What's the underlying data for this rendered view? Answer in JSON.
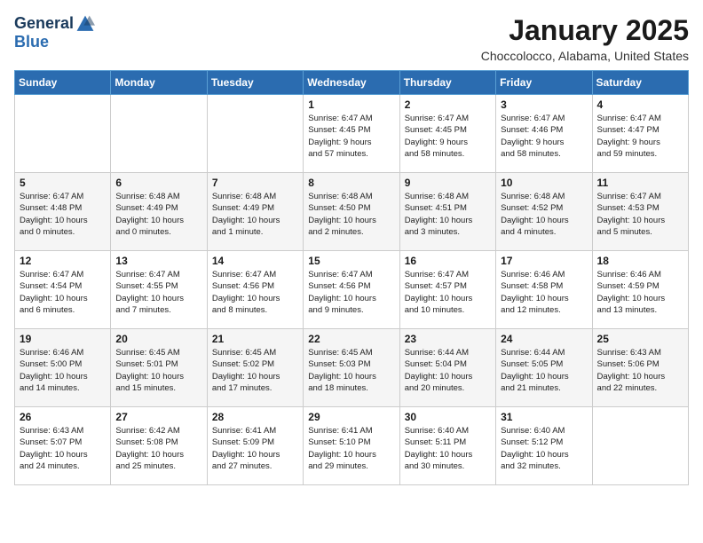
{
  "header": {
    "logo_general": "General",
    "logo_blue": "Blue",
    "title": "January 2025",
    "location": "Choccolocco, Alabama, United States"
  },
  "days_of_week": [
    "Sunday",
    "Monday",
    "Tuesday",
    "Wednesday",
    "Thursday",
    "Friday",
    "Saturday"
  ],
  "weeks": [
    [
      {
        "day": "",
        "info": ""
      },
      {
        "day": "",
        "info": ""
      },
      {
        "day": "",
        "info": ""
      },
      {
        "day": "1",
        "info": "Sunrise: 6:47 AM\nSunset: 4:45 PM\nDaylight: 9 hours\nand 57 minutes."
      },
      {
        "day": "2",
        "info": "Sunrise: 6:47 AM\nSunset: 4:45 PM\nDaylight: 9 hours\nand 58 minutes."
      },
      {
        "day": "3",
        "info": "Sunrise: 6:47 AM\nSunset: 4:46 PM\nDaylight: 9 hours\nand 58 minutes."
      },
      {
        "day": "4",
        "info": "Sunrise: 6:47 AM\nSunset: 4:47 PM\nDaylight: 9 hours\nand 59 minutes."
      }
    ],
    [
      {
        "day": "5",
        "info": "Sunrise: 6:47 AM\nSunset: 4:48 PM\nDaylight: 10 hours\nand 0 minutes."
      },
      {
        "day": "6",
        "info": "Sunrise: 6:48 AM\nSunset: 4:49 PM\nDaylight: 10 hours\nand 0 minutes."
      },
      {
        "day": "7",
        "info": "Sunrise: 6:48 AM\nSunset: 4:49 PM\nDaylight: 10 hours\nand 1 minute."
      },
      {
        "day": "8",
        "info": "Sunrise: 6:48 AM\nSunset: 4:50 PM\nDaylight: 10 hours\nand 2 minutes."
      },
      {
        "day": "9",
        "info": "Sunrise: 6:48 AM\nSunset: 4:51 PM\nDaylight: 10 hours\nand 3 minutes."
      },
      {
        "day": "10",
        "info": "Sunrise: 6:48 AM\nSunset: 4:52 PM\nDaylight: 10 hours\nand 4 minutes."
      },
      {
        "day": "11",
        "info": "Sunrise: 6:47 AM\nSunset: 4:53 PM\nDaylight: 10 hours\nand 5 minutes."
      }
    ],
    [
      {
        "day": "12",
        "info": "Sunrise: 6:47 AM\nSunset: 4:54 PM\nDaylight: 10 hours\nand 6 minutes."
      },
      {
        "day": "13",
        "info": "Sunrise: 6:47 AM\nSunset: 4:55 PM\nDaylight: 10 hours\nand 7 minutes."
      },
      {
        "day": "14",
        "info": "Sunrise: 6:47 AM\nSunset: 4:56 PM\nDaylight: 10 hours\nand 8 minutes."
      },
      {
        "day": "15",
        "info": "Sunrise: 6:47 AM\nSunset: 4:56 PM\nDaylight: 10 hours\nand 9 minutes."
      },
      {
        "day": "16",
        "info": "Sunrise: 6:47 AM\nSunset: 4:57 PM\nDaylight: 10 hours\nand 10 minutes."
      },
      {
        "day": "17",
        "info": "Sunrise: 6:46 AM\nSunset: 4:58 PM\nDaylight: 10 hours\nand 12 minutes."
      },
      {
        "day": "18",
        "info": "Sunrise: 6:46 AM\nSunset: 4:59 PM\nDaylight: 10 hours\nand 13 minutes."
      }
    ],
    [
      {
        "day": "19",
        "info": "Sunrise: 6:46 AM\nSunset: 5:00 PM\nDaylight: 10 hours\nand 14 minutes."
      },
      {
        "day": "20",
        "info": "Sunrise: 6:45 AM\nSunset: 5:01 PM\nDaylight: 10 hours\nand 15 minutes."
      },
      {
        "day": "21",
        "info": "Sunrise: 6:45 AM\nSunset: 5:02 PM\nDaylight: 10 hours\nand 17 minutes."
      },
      {
        "day": "22",
        "info": "Sunrise: 6:45 AM\nSunset: 5:03 PM\nDaylight: 10 hours\nand 18 minutes."
      },
      {
        "day": "23",
        "info": "Sunrise: 6:44 AM\nSunset: 5:04 PM\nDaylight: 10 hours\nand 20 minutes."
      },
      {
        "day": "24",
        "info": "Sunrise: 6:44 AM\nSunset: 5:05 PM\nDaylight: 10 hours\nand 21 minutes."
      },
      {
        "day": "25",
        "info": "Sunrise: 6:43 AM\nSunset: 5:06 PM\nDaylight: 10 hours\nand 22 minutes."
      }
    ],
    [
      {
        "day": "26",
        "info": "Sunrise: 6:43 AM\nSunset: 5:07 PM\nDaylight: 10 hours\nand 24 minutes."
      },
      {
        "day": "27",
        "info": "Sunrise: 6:42 AM\nSunset: 5:08 PM\nDaylight: 10 hours\nand 25 minutes."
      },
      {
        "day": "28",
        "info": "Sunrise: 6:41 AM\nSunset: 5:09 PM\nDaylight: 10 hours\nand 27 minutes."
      },
      {
        "day": "29",
        "info": "Sunrise: 6:41 AM\nSunset: 5:10 PM\nDaylight: 10 hours\nand 29 minutes."
      },
      {
        "day": "30",
        "info": "Sunrise: 6:40 AM\nSunset: 5:11 PM\nDaylight: 10 hours\nand 30 minutes."
      },
      {
        "day": "31",
        "info": "Sunrise: 6:40 AM\nSunset: 5:12 PM\nDaylight: 10 hours\nand 32 minutes."
      },
      {
        "day": "",
        "info": ""
      }
    ]
  ]
}
